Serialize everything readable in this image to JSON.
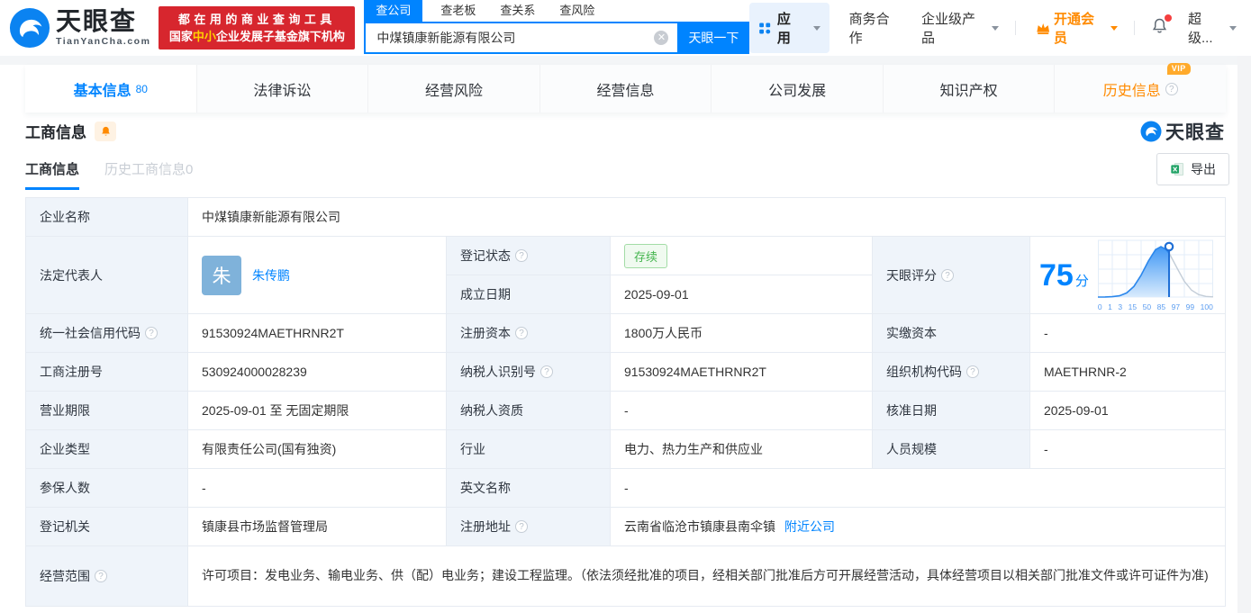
{
  "header": {
    "brand": {
      "name": "天眼查",
      "domain": "TianYanCha.com"
    },
    "slogan": {
      "line1": "都在用的商业查询工具",
      "line2_pre": "国家",
      "line2_em": "中小",
      "line2_post": "企业发展子基金旗下机构"
    },
    "search": {
      "tabs": [
        {
          "label": "查公司"
        },
        {
          "label": "查老板"
        },
        {
          "label": "查关系"
        },
        {
          "label": "查风险"
        }
      ],
      "value": "中煤镇康新能源有限公司",
      "submit": "天眼一下"
    },
    "nav": {
      "apps": "应用",
      "biz": "商务合作",
      "enterprise": "企业级产品",
      "vip": "开通会员",
      "super": "超级..."
    }
  },
  "tabbar": [
    {
      "label": "基本信息",
      "count": "80"
    },
    {
      "label": "法律诉讼"
    },
    {
      "label": "经营风险"
    },
    {
      "label": "经营信息"
    },
    {
      "label": "公司发展"
    },
    {
      "label": "知识产权"
    },
    {
      "label": "历史信息",
      "badge": "VIP"
    }
  ],
  "section": {
    "title": "工商信息",
    "watermark": "天眼查",
    "subtab_active": "工商信息",
    "subtab_history": "历史工商信息0",
    "export": "导出"
  },
  "table": {
    "company_name": {
      "label": "企业名称",
      "value": "中煤镇康新能源有限公司"
    },
    "legal_rep": {
      "label": "法定代表人",
      "avatar": "朱",
      "name": "朱传鹏"
    },
    "reg_status": {
      "label": "登记状态",
      "value": "存续"
    },
    "establish_date": {
      "label": "成立日期",
      "value": "2025-09-01"
    },
    "score": {
      "label": "天眼评分",
      "value": "75",
      "unit": "分"
    },
    "credit_code": {
      "label": "统一社会信用代码",
      "value": "91530924MAETHRNR2T"
    },
    "reg_capital": {
      "label": "注册资本",
      "value": "1800万人民币"
    },
    "paid_capital": {
      "label": "实缴资本",
      "value": "-"
    },
    "reg_number": {
      "label": "工商注册号",
      "value": "530924000028239"
    },
    "taxpayer_id": {
      "label": "纳税人识别号",
      "value": "91530924MAETHRNR2T"
    },
    "org_code": {
      "label": "组织机构代码",
      "value": "MAETHRNR-2"
    },
    "business_term": {
      "label": "营业期限",
      "value": "2025-09-01 至 无固定期限"
    },
    "taxpayer_quals": {
      "label": "纳税人资质",
      "value": "-"
    },
    "approval_date": {
      "label": "核准日期",
      "value": "2025-09-01"
    },
    "company_type": {
      "label": "企业类型",
      "value": "有限责任公司(国有独资)"
    },
    "industry": {
      "label": "行业",
      "value": "电力、热力生产和供应业"
    },
    "staff_size": {
      "label": "人员规模",
      "value": "-"
    },
    "insured_count": {
      "label": "参保人数",
      "value": "-"
    },
    "english_name": {
      "label": "英文名称",
      "value": "-"
    },
    "reg_authority": {
      "label": "登记机关",
      "value": "镇康县市场监督管理局"
    },
    "reg_address": {
      "label": "注册地址",
      "value": "云南省临沧市镇康县南伞镇",
      "link": "附近公司"
    },
    "business_scope": {
      "label": "经营范围",
      "value": "许可项目：发电业务、输电业务、供（配）电业务；建设工程监理。（依法须经批准的项目，经相关部门批准后方可开展经营活动，具体经营项目以相关部门批准文件或许可证件为准)"
    }
  },
  "chart_data": {
    "type": "area",
    "title": "天眼评分",
    "score": 75,
    "score_unit": "分",
    "marker_value": 75,
    "curve": "score-distribution-bell",
    "x_ticks": [
      "0",
      "1",
      "3",
      "15",
      "50",
      "85",
      "97",
      "99",
      "100"
    ],
    "legend": "none",
    "grid": true,
    "accent_color": "#0084ff"
  }
}
